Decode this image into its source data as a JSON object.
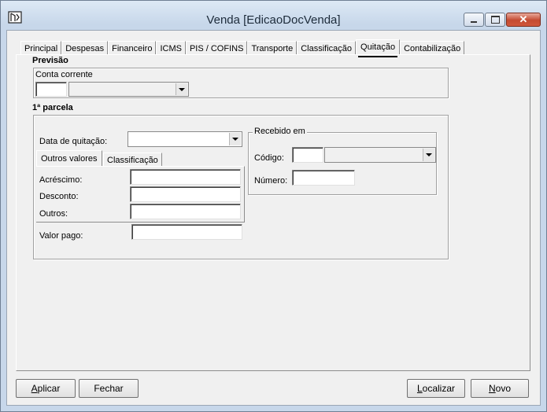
{
  "window": {
    "title": "Venda [EdicaoDocVenda]",
    "icon": "app-icon",
    "controls": {
      "minimize": "▭",
      "maximize": "▢",
      "close": "✕"
    }
  },
  "tabs": [
    {
      "label": "Principal"
    },
    {
      "label": "Despesas"
    },
    {
      "label": "Financeiro"
    },
    {
      "label": "ICMS"
    },
    {
      "label": "PIS / COFINS"
    },
    {
      "label": "Transporte"
    },
    {
      "label": "Classificação"
    },
    {
      "label": "Quitação",
      "selected": true
    },
    {
      "label": "Contabilização"
    }
  ],
  "previsao": {
    "heading": "Previsão",
    "conta_corrente_label": "Conta corrente",
    "conta_code": "",
    "conta_selected": ""
  },
  "parcela": {
    "heading": "1ª parcela",
    "data_quitacao_label": "Data de quitação:",
    "data_quitacao_value": "",
    "subtabs": [
      {
        "label": "Outros valores",
        "selected": true
      },
      {
        "label": "Classificação"
      }
    ],
    "acrescimo_label": "Acréscimo:",
    "desconto_label": "Desconto:",
    "outros_label": "Outros:",
    "valor_pago_label": "Valor pago:",
    "recebido_em": {
      "title": "Recebido em",
      "codigo_label": "Código:",
      "numero_label": "Número:"
    }
  },
  "buttons": {
    "aplicar_first": "A",
    "aplicar_rest": "plicar",
    "fechar": "Fechar",
    "localizar_first": "L",
    "localizar_rest": "ocalizar",
    "novo_first": "N",
    "novo_rest": "ovo"
  }
}
